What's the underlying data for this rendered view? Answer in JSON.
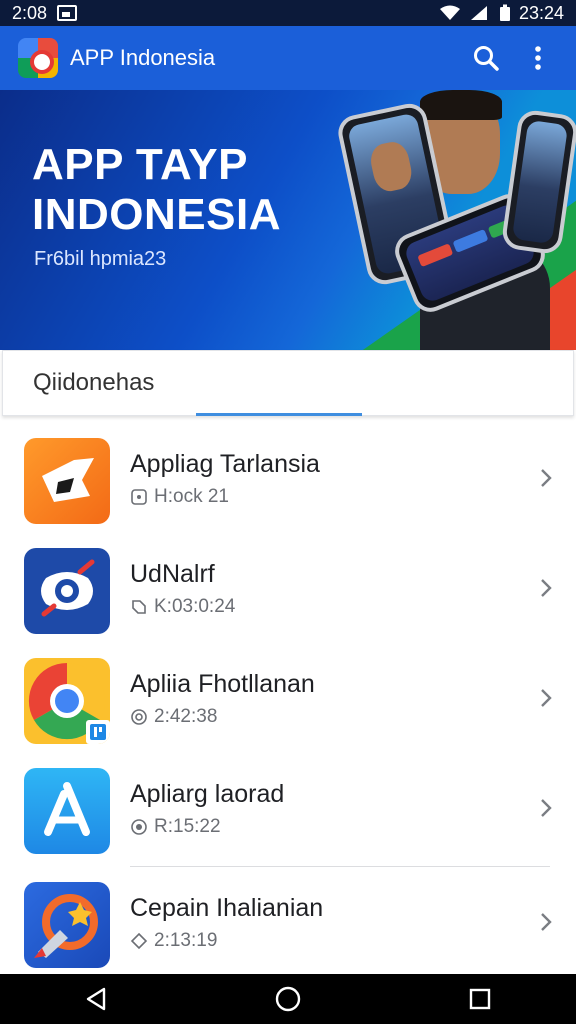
{
  "status_bar": {
    "time_left": "2:08",
    "time_right": "23:24"
  },
  "app_bar": {
    "title": "APP Indonesia"
  },
  "hero": {
    "title_line1": "APP TAYP",
    "title_line2": "INDONESIA",
    "subtitle": "Fr6bil hpmia23"
  },
  "search": {
    "label": "Qiidonehas"
  },
  "apps": [
    {
      "title": "Appliag Tarlansia",
      "meta": "H:ock 21",
      "icon": "orange-app-icon"
    },
    {
      "title": "UdNalrf",
      "meta": "K:03:0:24",
      "icon": "blue-target-app-icon"
    },
    {
      "title": "Apliia Fhotllanan",
      "meta": "2:42:38",
      "icon": "chrome-app-icon"
    },
    {
      "title": "Apliarg laorad",
      "meta": "R:15:22",
      "icon": "app-store-icon"
    },
    {
      "title": "Cepain Ihalianian",
      "meta": "2:13:19",
      "icon": "rocket-app-icon"
    }
  ],
  "colors": {
    "app_bar": "#1b5fd9",
    "accent": "#3f8ee0",
    "status_bar": "#0c1a3a"
  }
}
